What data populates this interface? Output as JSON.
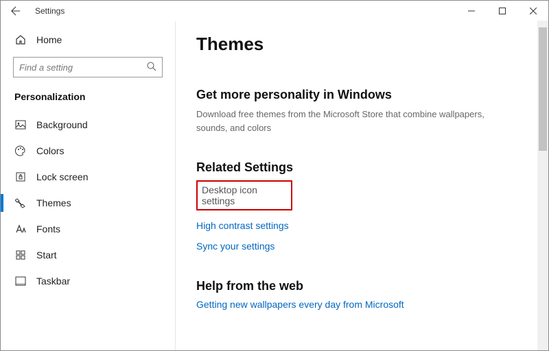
{
  "titlebar": {
    "title": "Settings"
  },
  "sidebar": {
    "home_label": "Home",
    "search_placeholder": "Find a setting",
    "section_label": "Personalization",
    "items": [
      {
        "label": "Background"
      },
      {
        "label": "Colors"
      },
      {
        "label": "Lock screen"
      },
      {
        "label": "Themes"
      },
      {
        "label": "Fonts"
      },
      {
        "label": "Start"
      },
      {
        "label": "Taskbar"
      }
    ]
  },
  "content": {
    "page_title": "Themes",
    "more_heading": "Get more personality in Windows",
    "more_desc": "Download free themes from the Microsoft Store that combine wallpapers, sounds, and colors",
    "related_heading": "Related Settings",
    "related_links": {
      "desktop_icon": "Desktop icon settings",
      "high_contrast": "High contrast settings",
      "sync": "Sync your settings"
    },
    "help_heading": "Help from the web",
    "help_link": "Getting new wallpapers every day from Microsoft"
  }
}
